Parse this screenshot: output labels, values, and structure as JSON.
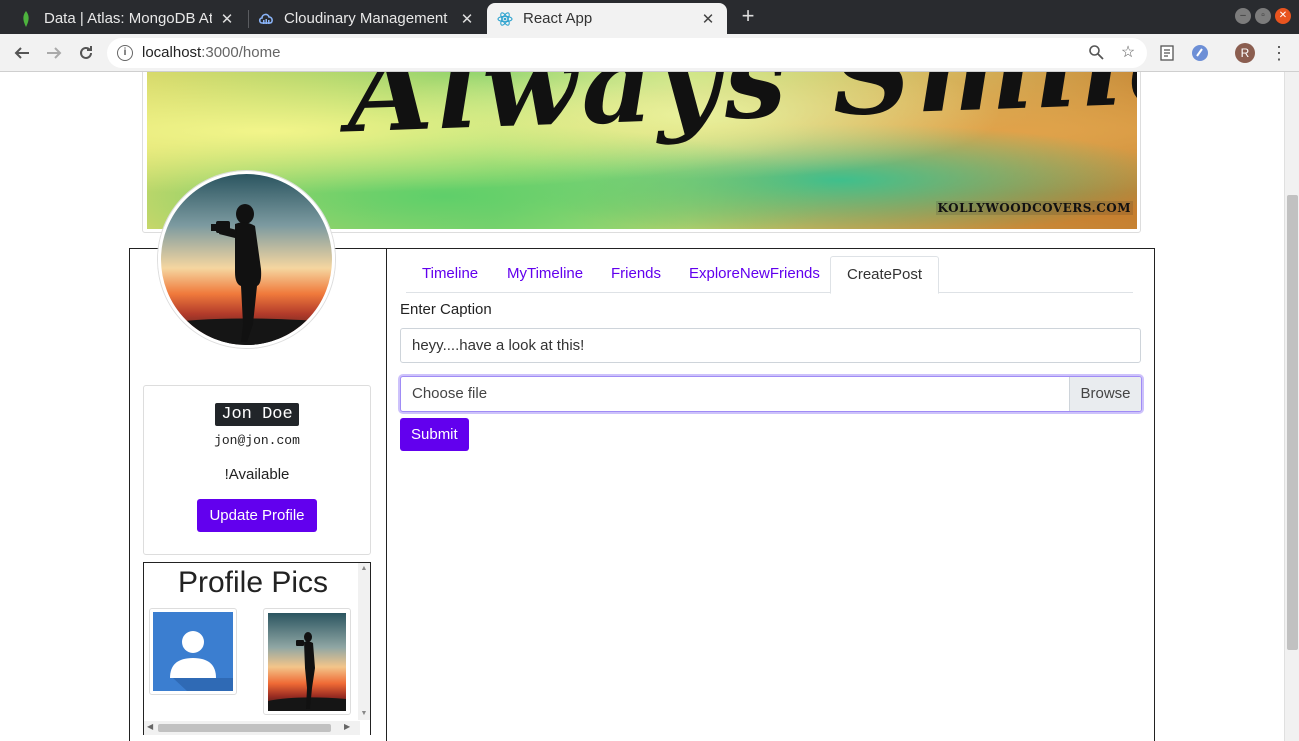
{
  "browser": {
    "tabs": [
      {
        "title": "Data | Atlas: MongoDB At",
        "icon": "mongodb-leaf-icon"
      },
      {
        "title": "Cloudinary Management C",
        "icon": "cloudinary-icon"
      },
      {
        "title": "React App",
        "icon": "react-icon"
      }
    ],
    "active_tab": 2,
    "url_host": "localhost",
    "url_path": ":3000/home"
  },
  "cover": {
    "text": "Always Smile :)",
    "watermark": "KOLLYWOODCOVERS.COM"
  },
  "profile": {
    "name": "Jon Doe",
    "email": "jon@jon.com",
    "status": "!Available",
    "update_button": "Update Profile"
  },
  "profile_pics": {
    "title": "Profile Pics"
  },
  "nav": {
    "tabs": [
      "Timeline",
      "MyTimeline",
      "Friends",
      "ExploreNewFriends",
      "CreatePost"
    ],
    "active": "CreatePost"
  },
  "create_post": {
    "caption_label": "Enter Caption",
    "caption_value": "heyy....have a look at this!",
    "file_placeholder": "Choose file",
    "browse_label": "Browse",
    "submit_label": "Submit"
  },
  "colors": {
    "accent": "#6200ee"
  }
}
